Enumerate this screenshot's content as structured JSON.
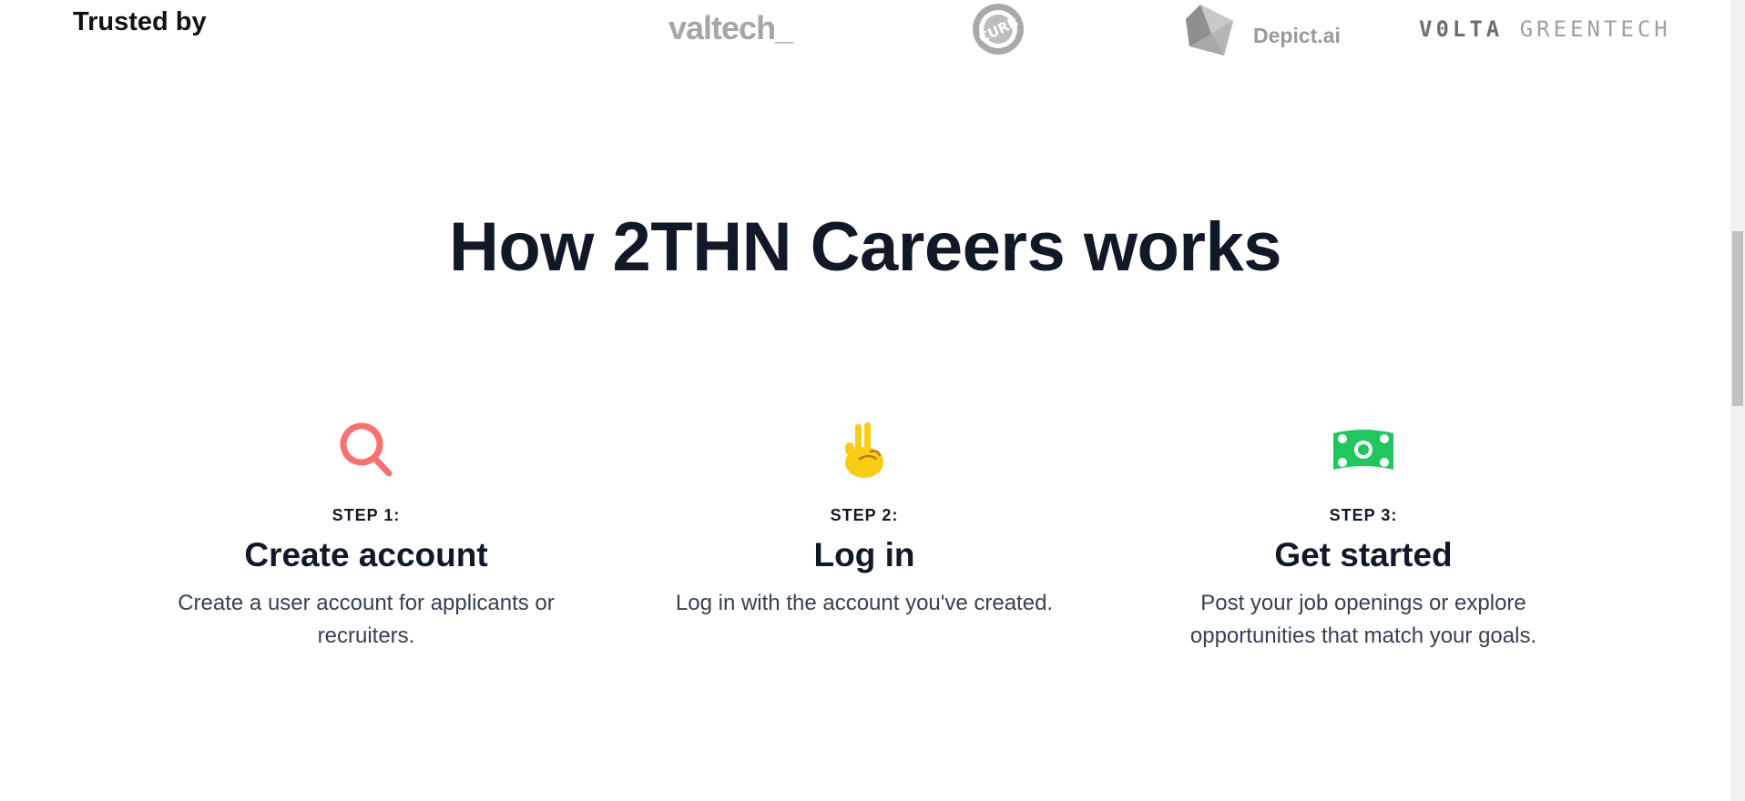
{
  "trusted": {
    "label": "Trusted by",
    "logos": {
      "valtech": "valtech_",
      "curb": "CURB",
      "depict": "Depict.ai",
      "volta_strong": "V0LTA",
      "volta_light": "GREENTECH"
    }
  },
  "section": {
    "title": "How 2THN Careers works"
  },
  "steps": [
    {
      "icon": "magnifying-glass-icon",
      "kicker": "STEP 1:",
      "title": "Create account",
      "description": "Create a user account for applicants or recruiters."
    },
    {
      "icon": "victory-hand-icon",
      "kicker": "STEP 2:",
      "title": "Log in",
      "description": "Log in with the account you've created."
    },
    {
      "icon": "banknote-icon",
      "kicker": "STEP 3:",
      "title": "Get started",
      "description": "Post your job openings or explore opportunities that match your goals."
    }
  ],
  "colors": {
    "heading": "#111827",
    "search_icon": "#f87171",
    "hand_icon": "#facc15",
    "money_icon": "#22c55e",
    "logo_gray": "#9a9a9a"
  }
}
